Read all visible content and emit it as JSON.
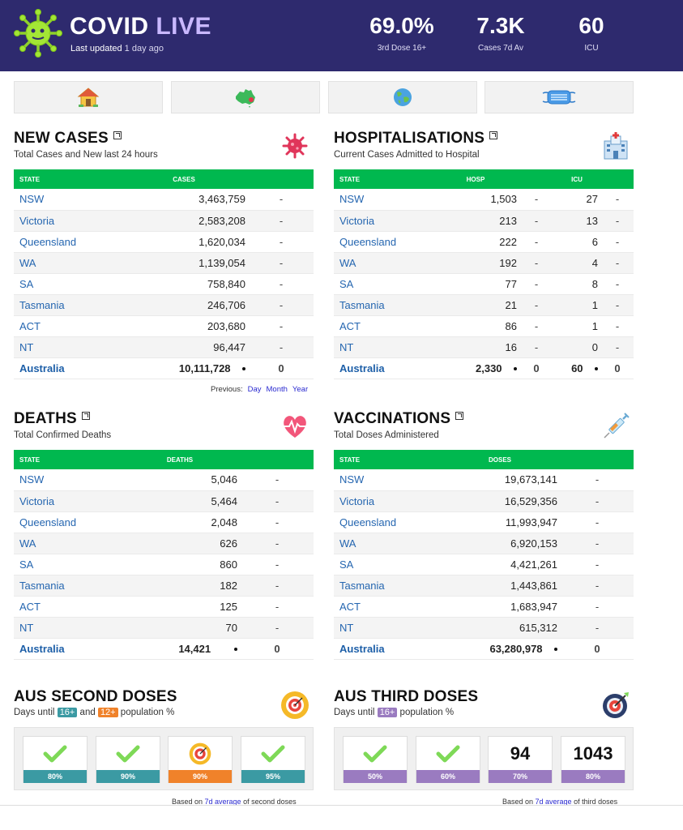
{
  "header": {
    "brand_white": "COVID",
    "brand_light": " LIVE",
    "updated_label": "Last updated",
    "updated_value": " 1 day ago",
    "stats": [
      {
        "value": "69.0%",
        "label": "3rd Dose 16+"
      },
      {
        "value": "7.3K",
        "label": "Cases 7d Av"
      },
      {
        "value": "60",
        "label": "ICU"
      }
    ]
  },
  "nav": {
    "items": [
      {
        "icon": "house-icon"
      },
      {
        "icon": "australia-map-icon"
      },
      {
        "icon": "globe-icon"
      },
      {
        "icon": "face-mask-icon"
      }
    ]
  },
  "new_cases": {
    "title": "NEW CASES",
    "subtitle": "Total Cases and New last 24 hours",
    "icon": "virus-icon",
    "headers": [
      "STATE",
      "CASES"
    ],
    "rows": [
      {
        "state": "NSW",
        "cases": "3,463,759",
        "new": "-"
      },
      {
        "state": "Victoria",
        "cases": "2,583,208",
        "new": "-"
      },
      {
        "state": "Queensland",
        "cases": "1,620,034",
        "new": "-"
      },
      {
        "state": "WA",
        "cases": "1,139,054",
        "new": "-"
      },
      {
        "state": "SA",
        "cases": "758,840",
        "new": "-"
      },
      {
        "state": "Tasmania",
        "cases": "246,706",
        "new": "-"
      },
      {
        "state": "ACT",
        "cases": "203,680",
        "new": "-"
      },
      {
        "state": "NT",
        "cases": "96,447",
        "new": "-"
      }
    ],
    "total": {
      "state": "Australia",
      "cases": "10,111,728",
      "new": "0"
    },
    "previous_label": "Previous:",
    "previous_links": [
      "Day",
      "Month",
      "Year"
    ]
  },
  "hospitalisations": {
    "title": "HOSPITALISATIONS",
    "subtitle": "Current Cases Admitted to Hospital",
    "icon": "hospital-icon",
    "headers": [
      "STATE",
      "HOSP",
      "ICU"
    ],
    "rows": [
      {
        "state": "NSW",
        "hosp": "1,503",
        "hosp_new": "-",
        "icu": "27",
        "icu_new": "-"
      },
      {
        "state": "Victoria",
        "hosp": "213",
        "hosp_new": "-",
        "icu": "13",
        "icu_new": "-"
      },
      {
        "state": "Queensland",
        "hosp": "222",
        "hosp_new": "-",
        "icu": "6",
        "icu_new": "-"
      },
      {
        "state": "WA",
        "hosp": "192",
        "hosp_new": "-",
        "icu": "4",
        "icu_new": "-"
      },
      {
        "state": "SA",
        "hosp": "77",
        "hosp_new": "-",
        "icu": "8",
        "icu_new": "-"
      },
      {
        "state": "Tasmania",
        "hosp": "21",
        "hosp_new": "-",
        "icu": "1",
        "icu_new": "-"
      },
      {
        "state": "ACT",
        "hosp": "86",
        "hosp_new": "-",
        "icu": "1",
        "icu_new": "-"
      },
      {
        "state": "NT",
        "hosp": "16",
        "hosp_new": "-",
        "icu": "0",
        "icu_new": "-"
      }
    ],
    "total": {
      "state": "Australia",
      "hosp": "2,330",
      "hosp_new": "0",
      "icu": "60",
      "icu_new": "0"
    }
  },
  "deaths": {
    "title": "DEATHS",
    "subtitle": "Total Confirmed Deaths",
    "icon": "heartbeat-icon",
    "headers": [
      "STATE",
      "DEATHS"
    ],
    "rows": [
      {
        "state": "NSW",
        "value": "5,046",
        "new": "-"
      },
      {
        "state": "Victoria",
        "value": "5,464",
        "new": "-"
      },
      {
        "state": "Queensland",
        "value": "2,048",
        "new": "-"
      },
      {
        "state": "WA",
        "value": "626",
        "new": "-"
      },
      {
        "state": "SA",
        "value": "860",
        "new": "-"
      },
      {
        "state": "Tasmania",
        "value": "182",
        "new": "-"
      },
      {
        "state": "ACT",
        "value": "125",
        "new": "-"
      },
      {
        "state": "NT",
        "value": "70",
        "new": "-"
      }
    ],
    "total": {
      "state": "Australia",
      "value": "14,421",
      "new": "0"
    }
  },
  "vaccinations": {
    "title": "VACCINATIONS",
    "subtitle": "Total Doses Administered",
    "icon": "syringe-icon",
    "headers": [
      "STATE",
      "DOSES"
    ],
    "rows": [
      {
        "state": "NSW",
        "value": "19,673,141",
        "new": "-"
      },
      {
        "state": "Victoria",
        "value": "16,529,356",
        "new": "-"
      },
      {
        "state": "Queensland",
        "value": "11,993,947",
        "new": "-"
      },
      {
        "state": "WA",
        "value": "6,920,153",
        "new": "-"
      },
      {
        "state": "SA",
        "value": "4,421,261",
        "new": "-"
      },
      {
        "state": "Tasmania",
        "value": "1,443,861",
        "new": "-"
      },
      {
        "state": "ACT",
        "value": "1,683,947",
        "new": "-"
      },
      {
        "state": "NT",
        "value": "615,312",
        "new": "-"
      }
    ],
    "total": {
      "state": "Australia",
      "value": "63,280,978",
      "new": "0"
    }
  },
  "second_doses": {
    "title": "AUS SECOND DOSES",
    "subtitle_prefix": "Days until ",
    "pill1": "16+",
    "pill_mid": " and ",
    "pill2": "12+",
    "subtitle_suffix": " population %",
    "icon": "target-icon",
    "cards": [
      {
        "content": "check",
        "label": "80%",
        "color": "#3b9aa3"
      },
      {
        "content": "check",
        "label": "90%",
        "color": "#3b9aa3"
      },
      {
        "content": "target",
        "label": "90%",
        "color": "#f0822a"
      },
      {
        "content": "check",
        "label": "95%",
        "color": "#3b9aa3"
      }
    ],
    "based_prefix": "Based on ",
    "based_link": "7d average",
    "based_suffix": " of second doses"
  },
  "third_doses": {
    "title": "AUS THIRD DOSES",
    "subtitle_prefix": "Days until ",
    "pill1": "16+",
    "subtitle_suffix": " population %",
    "icon": "target-arrow-icon",
    "cards": [
      {
        "content": "check",
        "label": "50%",
        "color": "#9a7bc0"
      },
      {
        "content": "check",
        "label": "60%",
        "color": "#9a7bc0"
      },
      {
        "content": "94",
        "label": "70%",
        "color": "#9a7bc0"
      },
      {
        "content": "1043",
        "label": "80%",
        "color": "#9a7bc0"
      }
    ],
    "based_prefix": "Based on ",
    "based_link": "7d average",
    "based_suffix": " of third doses"
  },
  "colors": {
    "header_bg": "#2e2a6e",
    "table_header": "#00b84f",
    "state_link": "#2566b0",
    "teal_pill": "#3b9aa3",
    "orange_pill": "#f0822a",
    "purple_pill": "#9a7bc0"
  }
}
